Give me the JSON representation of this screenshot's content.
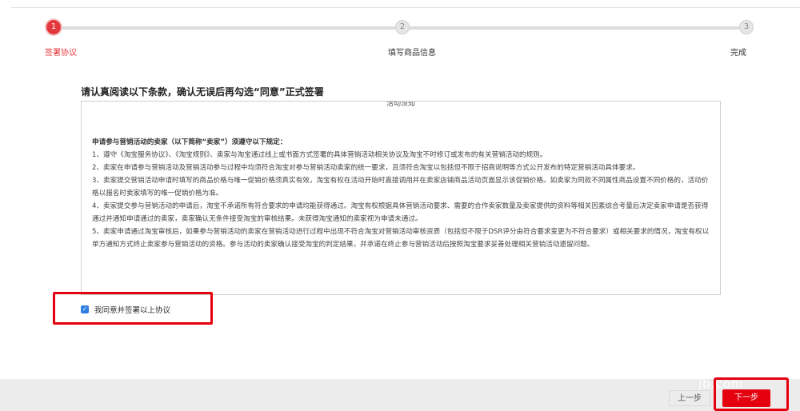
{
  "stepper": {
    "steps": [
      {
        "number": "1",
        "label": "签署协议"
      },
      {
        "number": "2",
        "label": "填写商品信息"
      },
      {
        "number": "3",
        "label": "完成"
      }
    ],
    "active_color": "#e4393c"
  },
  "agreement": {
    "heading": "请认真阅读以下条款，确认无误后再勾选“同意”正式签署",
    "box_title": "活动须知",
    "intro": "申请参与营销活动的卖家（以下简称“卖家”）须遵守以下规定：",
    "clauses": [
      "1、遵守《淘宝服务协议》、《淘宝规则》、卖家与淘宝通过线上或书面方式签署的具体营销活动相关协议及淘宝不时修订或发布的有关营销活动的规则。",
      "2、卖家在申请参与营销活动及营销活动参与过程中均须符合淘宝对参与营销活动卖家的统一要求，且须符合淘宝以包括但不限于招商说明等方式公开发布的特定营销活动具体要求。",
      "3、卖家提交营销活动申请时填写的商品价格与唯一促销价格须真实有效，淘宝有权在活动开始时直接调用并在卖家店铺商品活动页面显示该促销价格。如卖家为同款不同属性商品设置不同价格的，活动价格以报名时卖家填写的唯一促销价格为准。",
      "4、卖家提交参与营销活动的申请后，淘宝不承诺所有符合要求的申请均能获得通过。淘宝有权根据具体营销活动要求、需要的合作卖家数量及卖家提供的资料等相关因素综合考量后决定卖家申请是否获得通过并通知申请通过的卖家，卖家确认无条件接受淘宝的审核结果。未获得淘宝通知的卖家视为申请未通过。",
      "5、卖家申请通过淘宝审核后，如果参与营销活动的卖家在营销活动进行过程中出现不符合淘宝对营销活动审核资质（包括但不限于DSR评分由符合要求变更为不符合要求）或相关要求的情况，淘宝有权以单方通知方式终止卖家参与营销活动的资格。参与活动的卖家确认接受淘宝的判定结果，并承诺在终止参与营销活动后按照淘宝要求妥善处理相关营销活动遗留问题。"
    ],
    "checkbox_label": "我同意并签署以上协议",
    "checkbox_checked": true,
    "checkbox_color": "#2f7de1"
  },
  "footer": {
    "prev_label": "上一步",
    "next_label": "下一步",
    "watermark": "jb.com",
    "next_color": "#e4000e"
  }
}
